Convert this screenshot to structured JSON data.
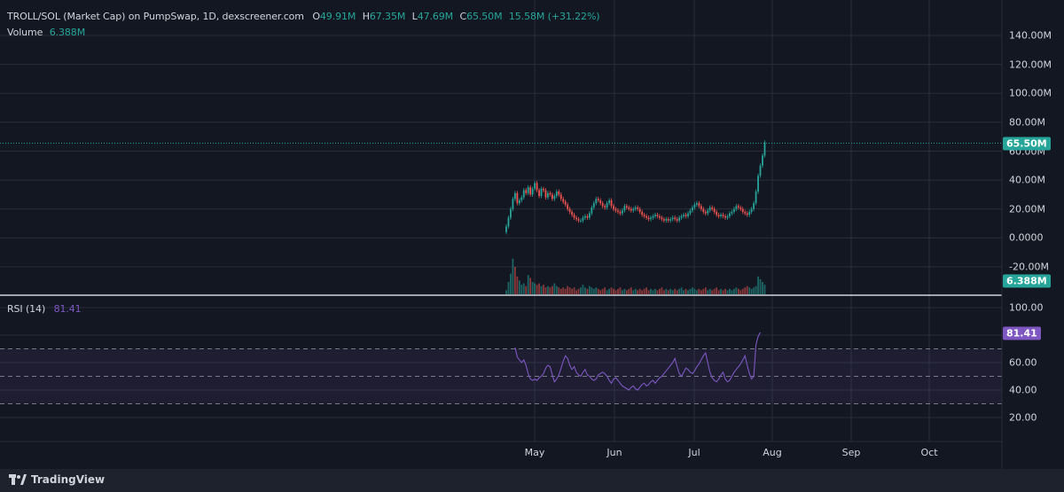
{
  "header": {
    "symbol": "TROLL/SOL (Market Cap) on PumpSwap, 1D, dexscreener.com",
    "o_key": "O",
    "o_val": "49.91M",
    "h_key": "H",
    "h_val": "67.35M",
    "l_key": "L",
    "l_val": "47.69M",
    "c_key": "C",
    "c_val": "65.50M",
    "change": "15.58M (+31.22%)",
    "volume_key": "Volume",
    "volume_val": "6.388M",
    "rsi_key": "RSI (14)",
    "rsi_val": "81.41"
  },
  "footer": {
    "brand": "TradingView"
  },
  "colors": {
    "up": "#26a69a",
    "down": "#ef5350",
    "rsi": "#7e57c2",
    "bg": "#131722",
    "grid": "#2a2e39"
  },
  "chart_data": [
    {
      "type": "candlestick",
      "y_ticks": [
        "140.00M",
        "120.00M",
        "100.00M",
        "80.00M",
        "60.00M",
        "40.00M",
        "20.00M",
        "0.0000",
        "-20.00M"
      ],
      "ylim": [
        -20,
        140
      ],
      "last_price_label": "65.50M",
      "last_price": 65.5,
      "x_ticks": [
        "May",
        "Jun",
        "Jul",
        "Aug",
        "Sep",
        "Oct"
      ],
      "close_series": [
        8,
        14,
        20,
        27,
        31,
        24,
        26,
        28,
        33,
        31,
        35,
        30,
        34,
        38,
        33,
        29,
        34,
        33,
        28,
        31,
        30,
        27,
        29,
        32,
        30,
        27,
        25,
        23,
        20,
        18,
        16,
        14,
        13,
        12,
        12,
        14,
        15,
        14,
        17,
        21,
        24,
        27,
        26,
        24,
        22,
        21,
        24,
        26,
        22,
        20,
        19,
        18,
        17,
        19,
        22,
        21,
        20,
        19,
        20,
        21,
        20,
        18,
        16,
        15,
        14,
        13,
        14,
        15,
        16,
        15,
        14,
        13,
        12,
        13,
        12,
        13,
        14,
        13,
        12,
        14,
        15,
        16,
        15,
        17,
        19,
        21,
        23,
        24,
        22,
        20,
        18,
        17,
        19,
        21,
        20,
        18,
        16,
        15,
        16,
        15,
        14,
        15,
        17,
        18,
        20,
        22,
        21,
        20,
        18,
        17,
        16,
        18,
        20,
        24,
        32,
        43,
        50,
        57,
        66
      ]
    },
    {
      "type": "bar",
      "name": "Volume",
      "last_label": "6.388M",
      "values": [
        3,
        9,
        15,
        26,
        20,
        13,
        10,
        7,
        8,
        6,
        14,
        12,
        9,
        8,
        7,
        8,
        6,
        7,
        5,
        6,
        5,
        6,
        8,
        6,
        5,
        4,
        5,
        4,
        6,
        5,
        4,
        5,
        3,
        4,
        5,
        7,
        5,
        4,
        6,
        5,
        4,
        5,
        4,
        3,
        4,
        5,
        3,
        4,
        5,
        4,
        3,
        4,
        5,
        3,
        4,
        3,
        4,
        5,
        3,
        4,
        3,
        4,
        3,
        4,
        5,
        3,
        4,
        3,
        4,
        3,
        4,
        5,
        3,
        4,
        3,
        4,
        3,
        4,
        3,
        4,
        5,
        3,
        4,
        3,
        4,
        5,
        4,
        3,
        4,
        3,
        4,
        5,
        3,
        4,
        3,
        4,
        5,
        3,
        4,
        3,
        4,
        3,
        4,
        3,
        4,
        5,
        4,
        3,
        4,
        5,
        6,
        5,
        4,
        5,
        6,
        13,
        11,
        9,
        7
      ],
      "up": [
        true,
        true,
        true,
        true,
        false,
        false,
        true,
        true,
        true,
        false,
        true,
        false,
        true,
        true,
        false,
        false,
        true,
        false,
        false,
        true,
        false,
        false,
        true,
        true,
        false,
        false,
        false,
        false,
        false,
        false,
        false,
        false,
        false,
        false,
        true,
        true,
        true,
        false,
        true,
        true,
        true,
        true,
        false,
        false,
        false,
        false,
        true,
        true,
        false,
        false,
        false,
        false,
        false,
        true,
        true,
        false,
        false,
        false,
        true,
        true,
        false,
        false,
        false,
        false,
        false,
        false,
        true,
        true,
        true,
        false,
        false,
        false,
        false,
        true,
        false,
        true,
        true,
        false,
        false,
        true,
        true,
        true,
        false,
        true,
        true,
        true,
        true,
        true,
        false,
        false,
        false,
        false,
        true,
        true,
        false,
        false,
        false,
        false,
        true,
        false,
        false,
        true,
        true,
        true,
        true,
        true,
        false,
        false,
        false,
        false,
        false,
        true,
        true,
        true,
        true,
        true,
        true,
        true,
        true
      ]
    },
    {
      "type": "line",
      "name": "RSI (14)",
      "y_ticks": [
        "100.00",
        "80.00",
        "60.00",
        "40.00",
        "20.00"
      ],
      "ylim": [
        10,
        100
      ],
      "bands": [
        30,
        50,
        70
      ],
      "last_label": "81.41",
      "start_index": 4,
      "values": [
        71,
        64,
        62,
        60,
        62,
        58,
        52,
        48,
        47,
        48,
        47,
        49,
        50,
        52,
        56,
        58,
        57,
        51,
        46,
        48,
        51,
        56,
        61,
        65,
        63,
        58,
        55,
        57,
        53,
        51,
        50,
        53,
        55,
        51,
        50,
        48,
        47,
        48,
        51,
        52,
        53,
        52,
        50,
        47,
        45,
        48,
        49,
        47,
        45,
        43,
        42,
        41,
        40,
        42,
        43,
        41,
        40,
        42,
        44,
        45,
        43,
        44,
        46,
        47,
        45,
        47,
        49,
        50,
        52,
        54,
        56,
        58,
        60,
        63,
        57,
        52,
        50,
        53,
        56,
        55,
        53,
        52,
        54,
        57,
        59,
        62,
        65,
        67,
        60,
        53,
        49,
        47,
        46,
        48,
        51,
        53,
        48,
        46,
        47,
        50,
        53,
        55,
        57,
        59,
        62,
        65,
        58,
        52,
        48,
        50,
        73,
        79,
        82
      ]
    }
  ]
}
